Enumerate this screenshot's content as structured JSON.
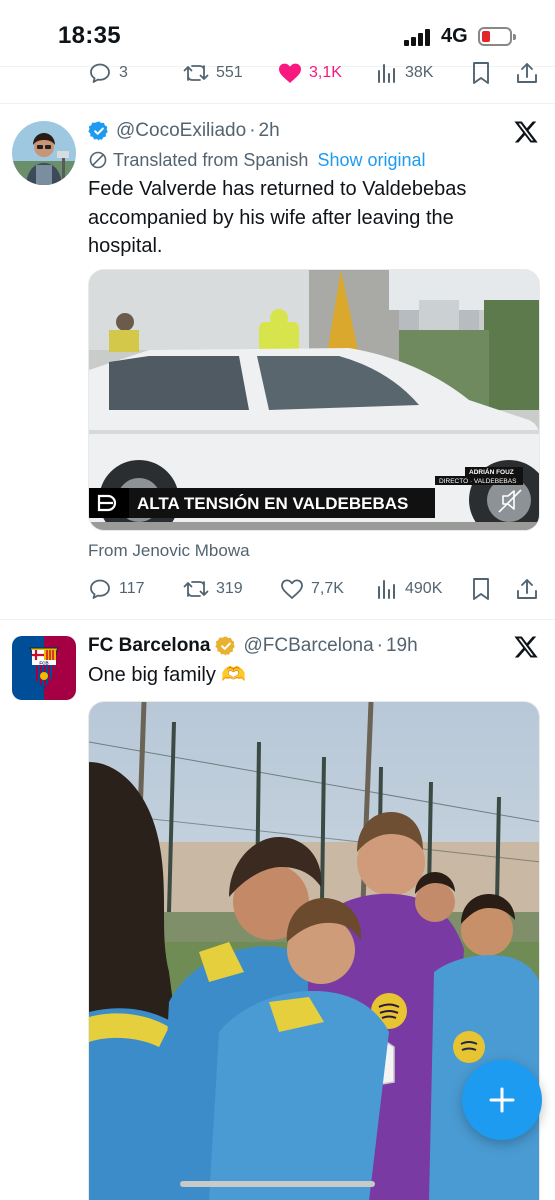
{
  "status_bar": {
    "time": "18:35",
    "network": "4G"
  },
  "prev_tweet_actions": {
    "replies": "3",
    "reposts": "551",
    "likes": "3,1K",
    "views": "38K",
    "liked": true,
    "like_color": "#f91880"
  },
  "tweet1": {
    "handle": "@CocoExiliado",
    "separator": "·",
    "time": "2h",
    "translated_label": "Translated from Spanish",
    "show_original": "Show original",
    "text": "Fede Valverde has returned to Valdebebas accompanied by his wife after leaving the hospital.",
    "video": {
      "caption": "ALTA TENSIÓN EN VALDEBEBAS",
      "credit_name": "ADRIÁN FOUZ",
      "credit_sub": "DIRECTO · VALDEBEBAS",
      "muted": true
    },
    "from": "From Jenovic Mbowa",
    "actions": {
      "replies": "117",
      "reposts": "319",
      "likes": "7,7K",
      "views": "490K"
    }
  },
  "tweet2": {
    "name": "FC Barcelona",
    "handle": "@FCBarcelona",
    "separator": "·",
    "time": "19h",
    "text": "One big family 🫶",
    "crest_text": "FCB"
  },
  "colors": {
    "accent": "#1d9bf0",
    "muted_text": "#536471",
    "verified_gold": "#e8b130",
    "barca_blue": "#004d98",
    "barca_red": "#a50044"
  },
  "icons": {
    "reply": "reply-icon",
    "repost": "repost-icon",
    "like": "heart-icon",
    "views": "views-icon",
    "bookmark": "bookmark-icon",
    "share": "share-icon",
    "compose": "plus-icon"
  }
}
